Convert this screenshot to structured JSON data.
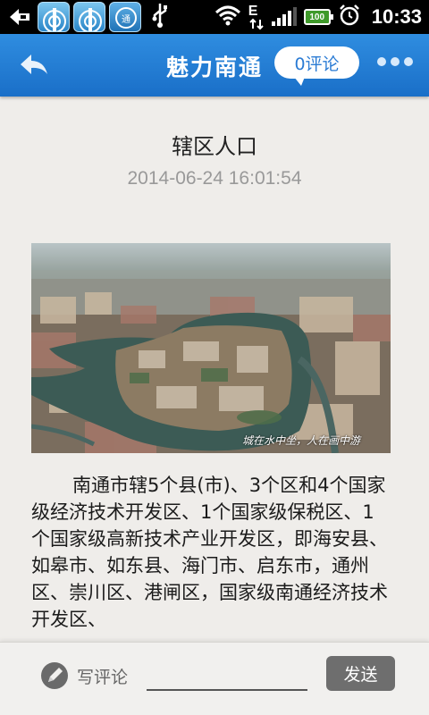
{
  "status_bar": {
    "time": "10:33",
    "battery_text": "100",
    "network_type": "E",
    "app2_text": "通",
    "icons": [
      "back-arrow-icon",
      "radio-tower-icon",
      "radio-tower-icon",
      "nantong-app-icon",
      "usb-icon",
      "wifi-icon",
      "network-e-icon",
      "signal-icon",
      "battery-icon",
      "alarm-icon"
    ]
  },
  "titlebar": {
    "title": "魅力南通",
    "comment_count_label": "0评论",
    "colors": {
      "bar": "#1f78d1",
      "bubble_text": "#2a7bd4"
    }
  },
  "article": {
    "title": "辖区人口",
    "date": "2014-06-24 16:01:54",
    "photo_caption": "城在水中坐，人在画中游",
    "body": "南通市辖5个县(市)、3个区和4个国家级经济技术开发区、1个国家级保税区、1个国家级高新技术产业开发区，即海安县、如皋市、如东县、海门市、启东市，通州区、崇川区、港闸区，国家级南通经济技术开发区、"
  },
  "bottom_bar": {
    "write_label": "写评论",
    "input_value": "",
    "input_placeholder": "",
    "send_label": "发送"
  }
}
